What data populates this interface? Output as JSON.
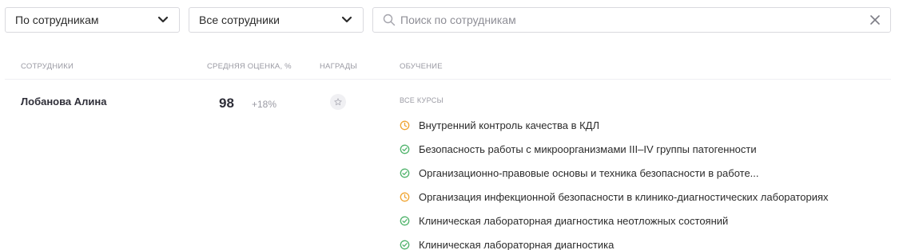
{
  "filters": {
    "group_by": {
      "value": "По сотрудникам",
      "icon": "chevron-down-icon"
    },
    "employees": {
      "value": "Все сотрудники",
      "icon": "chevron-down-icon"
    },
    "search": {
      "placeholder": "Поиск по сотрудникам",
      "value": "",
      "icon": "search-icon",
      "clear_icon": "close-icon"
    }
  },
  "table": {
    "headers": {
      "employees": "Сотрудники",
      "average_score": "Средняя оценка, %",
      "awards": "Награды",
      "learning": "Обучение"
    },
    "rows": [
      {
        "name": "Лобанова Алина",
        "score": "98",
        "delta": "+18%",
        "award_icon": "star-icon",
        "courses_label": "Все курсы",
        "courses": [
          {
            "title": "Внутренний контроль качества в КДЛ",
            "status": "in-progress"
          },
          {
            "title": "Безопасность работы с микроорганизмами III–IV группы патогенности",
            "status": "completed"
          },
          {
            "title": "Организационно-правовые основы и техника безопасности в работе...",
            "status": "completed"
          },
          {
            "title": "Организация инфекционной безопасности в клинико-диагностических лабораториях",
            "status": "in-progress"
          },
          {
            "title": "Клиническая лабораторная диагностика неотложных состояний",
            "status": "completed"
          },
          {
            "title": "Клиническая лабораторная диагностика",
            "status": "completed"
          }
        ]
      }
    ]
  },
  "colors": {
    "completed": "#4fb36b",
    "in_progress": "#f0a532",
    "muted": "#9a9aa3",
    "text": "#2b2b2b"
  }
}
